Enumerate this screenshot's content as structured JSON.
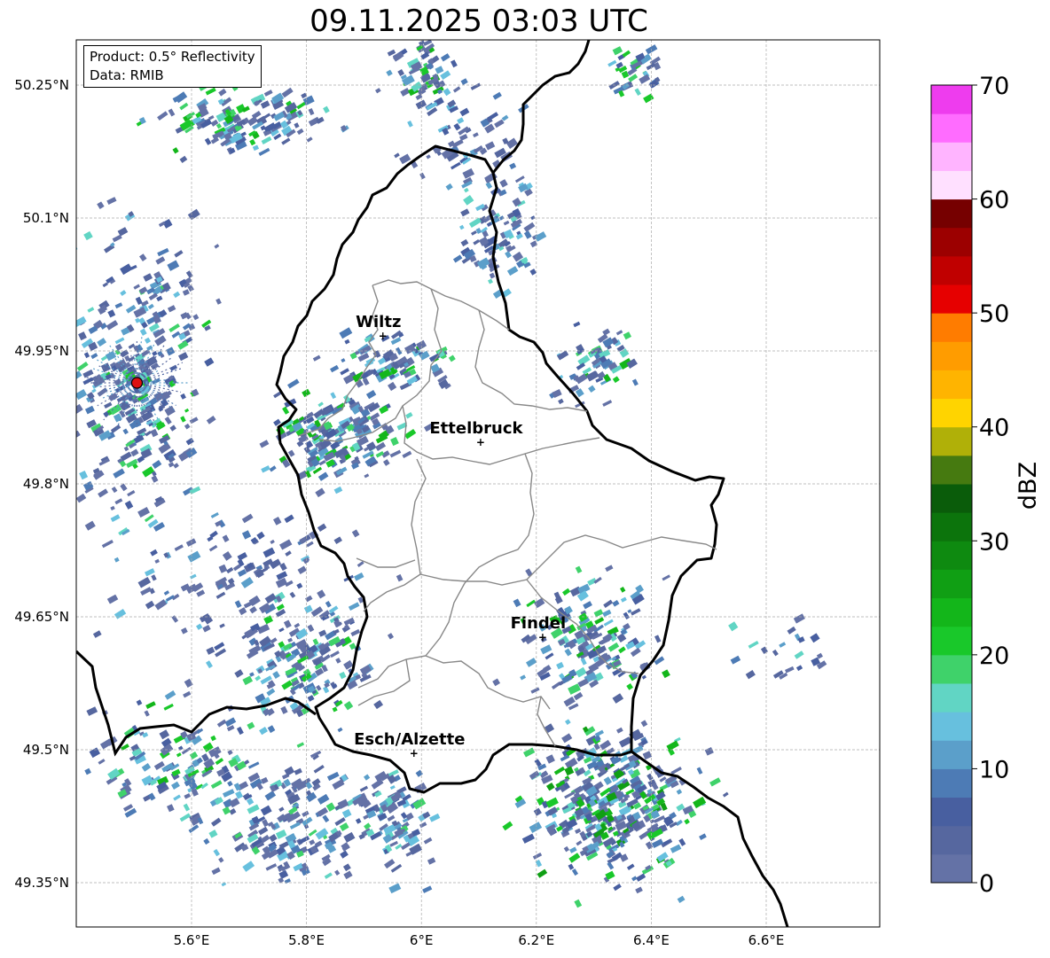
{
  "title": "09.11.2025 03:03 UTC",
  "info_box": {
    "product": "Product: 0.5° Reflectivity",
    "data": "Data: RMIB"
  },
  "map": {
    "lon_range": [
      5.4,
      6.8
    ],
    "lat_range": [
      49.3,
      50.3
    ],
    "lon_ticks": [
      {
        "value": 5.6,
        "label": "5.6°E"
      },
      {
        "value": 5.8,
        "label": "5.8°E"
      },
      {
        "value": 6.0,
        "label": "6°E"
      },
      {
        "value": 6.2,
        "label": "6.2°E"
      },
      {
        "value": 6.4,
        "label": "6.4°E"
      },
      {
        "value": 6.6,
        "label": "6.6°E"
      }
    ],
    "lat_ticks": [
      {
        "value": 50.25,
        "label": "50.25°N"
      },
      {
        "value": 50.1,
        "label": "50.1°N"
      },
      {
        "value": 49.95,
        "label": "49.95°N"
      },
      {
        "value": 49.8,
        "label": "49.8°N"
      },
      {
        "value": 49.65,
        "label": "49.65°N"
      },
      {
        "value": 49.5,
        "label": "49.5°N"
      },
      {
        "value": 49.35,
        "label": "49.35°N"
      }
    ],
    "gridlines": true,
    "radar_site": {
      "lon": 5.505,
      "lat": 49.914,
      "color": "#dd1111"
    },
    "cities": [
      {
        "name": "Wiltz",
        "lon": 5.933,
        "lat": 49.967
      },
      {
        "name": "Ettelbruck",
        "lon": 6.103,
        "lat": 49.847
      },
      {
        "name": "Findel",
        "lon": 6.211,
        "lat": 49.627
      },
      {
        "name": "Esch/Alzette",
        "lon": 5.987,
        "lat": 49.496
      }
    ]
  },
  "colorbar": {
    "label": "dBZ",
    "min": 0,
    "max": 70,
    "step": 2.5,
    "ticks": [
      {
        "value": 0,
        "label": "0"
      },
      {
        "value": 10,
        "label": "10"
      },
      {
        "value": 20,
        "label": "20"
      },
      {
        "value": 30,
        "label": "30"
      },
      {
        "value": 40,
        "label": "40"
      },
      {
        "value": 50,
        "label": "50"
      },
      {
        "value": 60,
        "label": "60"
      },
      {
        "value": 70,
        "label": "70"
      }
    ],
    "colors": [
      "#6472a6",
      "#56679f",
      "#485fa0",
      "#4d7bb5",
      "#5b9fca",
      "#67c0de",
      "#61d5c4",
      "#3fd26a",
      "#19c82a",
      "#13b61a",
      "#109f14",
      "#0e8a10",
      "#0c740c",
      "#0a5c0a",
      "#467a10",
      "#b0b008",
      "#ffd400",
      "#ffb400",
      "#ff9c00",
      "#ff7c00",
      "#e60000",
      "#c00000",
      "#9c0000",
      "#760000",
      "#ffe0ff",
      "#ffb4ff",
      "#ff6cff",
      "#ee3cee"
    ]
  }
}
